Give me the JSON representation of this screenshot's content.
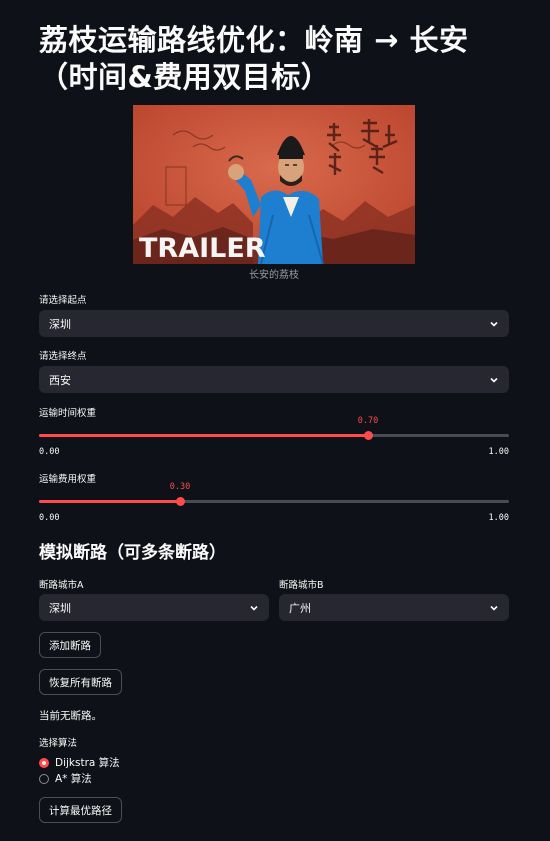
{
  "title": "荔枝运输路线优化：岭南 → 长安（时间&费用双目标）",
  "hero": {
    "caption": "长安的荔枝",
    "overlay_text": "TRAILER",
    "calligraphy": "荔枝長安",
    "seal_text": "长安"
  },
  "start": {
    "label": "请选择起点",
    "value": "深圳"
  },
  "end": {
    "label": "请选择终点",
    "value": "西安"
  },
  "time_weight": {
    "label": "运输时间权重",
    "value": 0.7,
    "value_text": "0.70",
    "min_text": "0.00",
    "max_text": "1.00"
  },
  "cost_weight": {
    "label": "运输费用权重",
    "value": 0.3,
    "value_text": "0.30",
    "min_text": "0.00",
    "max_text": "1.00"
  },
  "roadblock": {
    "heading": "模拟断路（可多条断路）",
    "city_a_label": "断路城市A",
    "city_a_value": "深圳",
    "city_b_label": "断路城市B",
    "city_b_value": "广州",
    "add_button": "添加断路",
    "reset_button": "恢复所有断路",
    "status": "当前无断路。"
  },
  "algorithm": {
    "label": "选择算法",
    "options": [
      "Dijkstra 算法",
      "A* 算法"
    ],
    "selected": "Dijkstra 算法"
  },
  "compute_button": "计算最优路径",
  "colors": {
    "background": "#0e1117",
    "accent": "#ff4b4b",
    "widget": "#262730",
    "text": "#fafafa"
  },
  "icons": {
    "select_chevron": "chevron-down-icon"
  }
}
